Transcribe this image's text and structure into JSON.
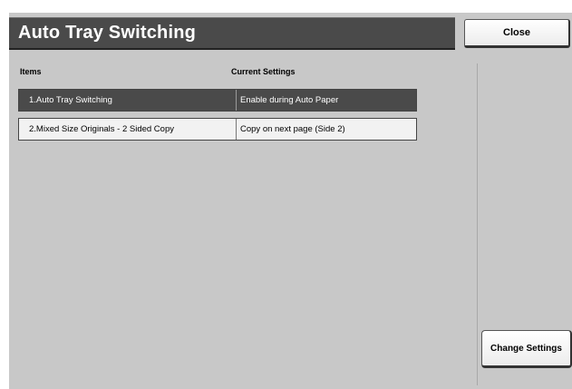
{
  "window": {
    "title": "Auto Tray Switching",
    "close_label": "Close"
  },
  "table": {
    "headers": [
      "Items",
      "Current Settings"
    ],
    "rows": [
      {
        "item": "1.Auto Tray Switching",
        "setting": "Enable during Auto Paper",
        "selected": true
      },
      {
        "item": "2.Mixed Size Originals - 2 Sided Copy",
        "setting": "Copy on next page (Side 2)",
        "selected": false
      }
    ]
  },
  "actions": {
    "change_settings_label": "Change Settings"
  },
  "colors": {
    "title_bar": "#4a4a4a",
    "background": "#c8c8c8",
    "selected_row": "#4a4a4a",
    "row": "#f2f2f2"
  }
}
